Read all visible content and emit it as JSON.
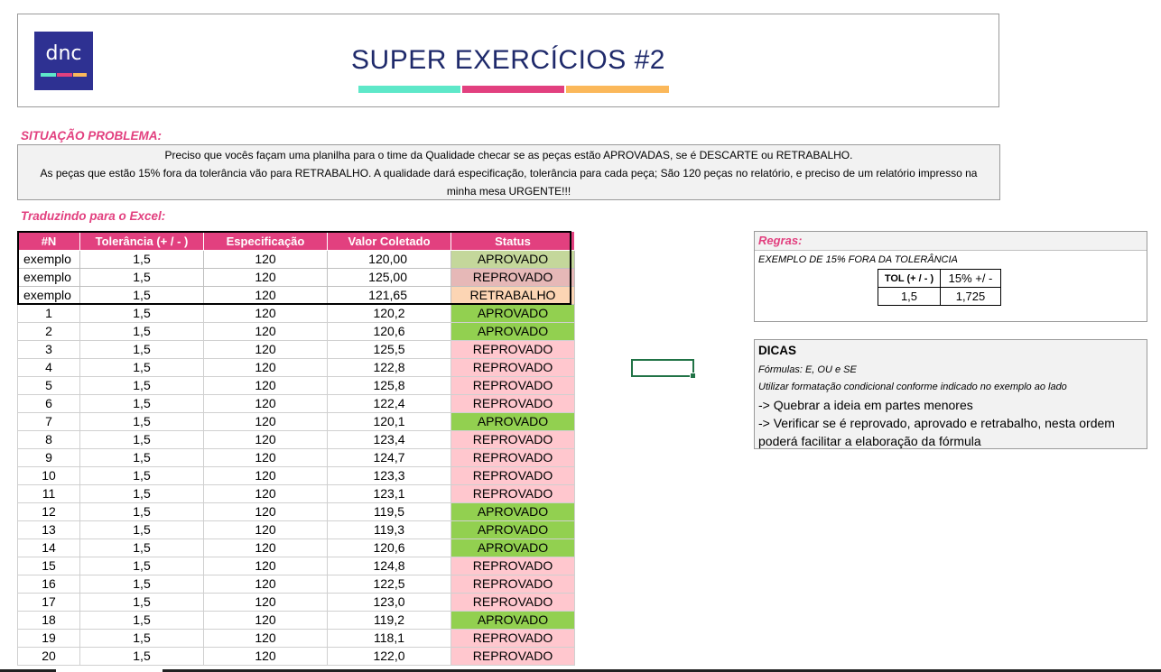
{
  "header": {
    "logo_text": "dnc",
    "title": "SUPER EXERCÍCIOS #2",
    "stripe_colors": [
      "#5ee8c9",
      "#e2407f",
      "#fbb85a"
    ]
  },
  "problem": {
    "label": "SITUAÇÃO PROBLEMA:",
    "line1": "Preciso que vocês façam uma planilha para o time da Qualidade checar se as peças estão APROVADAS,  se é DESCARTE ou RETRABALHO.",
    "line2": "As peças que estão 15% fora da tolerância vão para RETRABALHO. A qualidade dará especificação, tolerância para cada peça; São 120 peças no relatório, e preciso de um relatório impresso na",
    "line3": "minha mesa URGENTE!!!"
  },
  "translate_label": "Traduzindo para o Excel:",
  "table": {
    "headers": [
      "#N",
      "Tolerância (+ / - )",
      "Especificação",
      "Valor Coletado",
      "Status"
    ],
    "examples": [
      {
        "n": "exemplo",
        "tol": "1,5",
        "spec": "120",
        "val": "120,00",
        "status": "APROVADO",
        "color": "#c4d79b"
      },
      {
        "n": "exemplo",
        "tol": "1,5",
        "spec": "120",
        "val": "125,00",
        "status": "REPROVADO",
        "color": "#e6b8b7"
      },
      {
        "n": "exemplo",
        "tol": "1,5",
        "spec": "120",
        "val": "121,65",
        "status": "RETRABALHO",
        "color": "#fcd5b4"
      }
    ],
    "rows": [
      {
        "n": "1",
        "tol": "1,5",
        "spec": "120",
        "val": "120,2",
        "status": "APROVADO"
      },
      {
        "n": "2",
        "tol": "1,5",
        "spec": "120",
        "val": "120,6",
        "status": "APROVADO"
      },
      {
        "n": "3",
        "tol": "1,5",
        "spec": "120",
        "val": "125,5",
        "status": "REPROVADO"
      },
      {
        "n": "4",
        "tol": "1,5",
        "spec": "120",
        "val": "122,8",
        "status": "REPROVADO"
      },
      {
        "n": "5",
        "tol": "1,5",
        "spec": "120",
        "val": "125,8",
        "status": "REPROVADO"
      },
      {
        "n": "6",
        "tol": "1,5",
        "spec": "120",
        "val": "122,4",
        "status": "REPROVADO"
      },
      {
        "n": "7",
        "tol": "1,5",
        "spec": "120",
        "val": "120,1",
        "status": "APROVADO"
      },
      {
        "n": "8",
        "tol": "1,5",
        "spec": "120",
        "val": "123,4",
        "status": "REPROVADO"
      },
      {
        "n": "9",
        "tol": "1,5",
        "spec": "120",
        "val": "124,7",
        "status": "REPROVADO"
      },
      {
        "n": "10",
        "tol": "1,5",
        "spec": "120",
        "val": "123,3",
        "status": "REPROVADO"
      },
      {
        "n": "11",
        "tol": "1,5",
        "spec": "120",
        "val": "123,1",
        "status": "REPROVADO"
      },
      {
        "n": "12",
        "tol": "1,5",
        "spec": "120",
        "val": "119,5",
        "status": "APROVADO"
      },
      {
        "n": "13",
        "tol": "1,5",
        "spec": "120",
        "val": "119,3",
        "status": "APROVADO"
      },
      {
        "n": "14",
        "tol": "1,5",
        "spec": "120",
        "val": "120,6",
        "status": "APROVADO"
      },
      {
        "n": "15",
        "tol": "1,5",
        "spec": "120",
        "val": "124,8",
        "status": "REPROVADO"
      },
      {
        "n": "16",
        "tol": "1,5",
        "spec": "120",
        "val": "122,5",
        "status": "REPROVADO"
      },
      {
        "n": "17",
        "tol": "1,5",
        "spec": "120",
        "val": "123,0",
        "status": "REPROVADO"
      },
      {
        "n": "18",
        "tol": "1,5",
        "spec": "120",
        "val": "119,2",
        "status": "APROVADO"
      },
      {
        "n": "19",
        "tol": "1,5",
        "spec": "120",
        "val": "118,1",
        "status": "REPROVADO"
      },
      {
        "n": "20",
        "tol": "1,5",
        "spec": "120",
        "val": "122,0",
        "status": "REPROVADO"
      }
    ],
    "status_colors": {
      "APROVADO": "#92d050",
      "REPROVADO": "#ffc7ce"
    }
  },
  "rules": {
    "label": "Regras:",
    "example_text": "EXEMPLO DE 15% FORA DA TOLERÂNCIA",
    "col1_header": "TOL (+ / - )",
    "col2_header": "15% +/ -",
    "col1_value": "1,5",
    "col2_value": "1,725"
  },
  "tips": {
    "title": "DICAS",
    "line1": "Fórmulas: E, OU e SE",
    "line2": "Utilizar formatação condicional conforme indicado no exemplo ao lado",
    "line3": "-> Quebrar a ideia em partes menores",
    "line4": "-> Verificar se é reprovado, aprovado e retrabalho, nesta ordem",
    "line5": "poderá facilitar a elaboração da fórmula"
  }
}
